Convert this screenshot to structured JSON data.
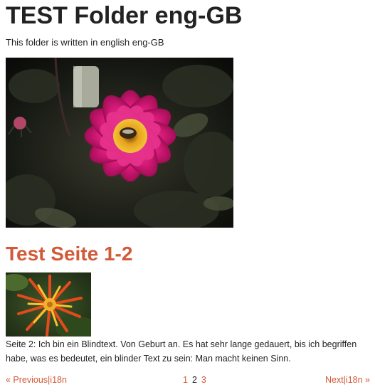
{
  "folder": {
    "title": "TEST Folder eng-GB",
    "description": "This folder is written in english eng-GB",
    "hero_image_alt": "pink-dahlia-photo"
  },
  "child": {
    "title": "Test Seite 1-2",
    "thumbnail_alt": "orange-dahlia-photo",
    "text": "Seite 2: Ich bin ein Blindtext. Von Geburt an. Es hat sehr lange gedauert, bis ich begriffen habe, was es bedeutet, ein blinder Text zu sein: Man macht keinen Sinn."
  },
  "pager": {
    "prev_label": "« Previous|i18n",
    "next_label": "Next|i18n »",
    "pages": [
      {
        "label": "1",
        "current": false
      },
      {
        "label": "2",
        "current": true
      },
      {
        "label": "3",
        "current": false
      }
    ]
  },
  "colors": {
    "accent": "#d25a38",
    "text": "#222222",
    "background": "#ffffff"
  }
}
